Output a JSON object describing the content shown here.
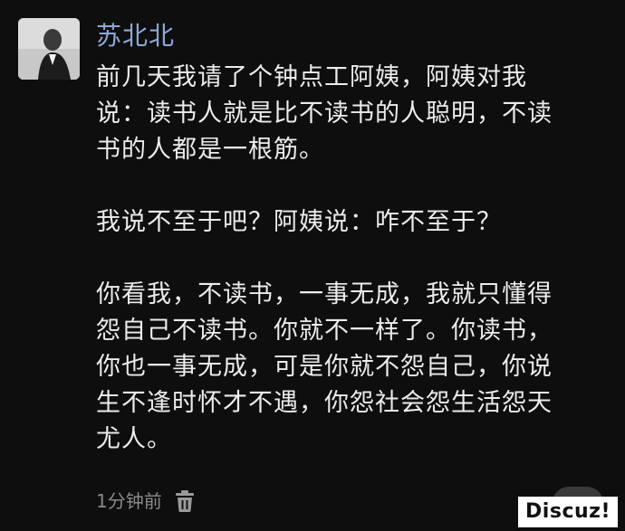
{
  "post": {
    "username": "苏北北",
    "paragraphs": [
      "前几天我请了个钟点工阿姨，阿姨对我\n说：读书人就是比不读书的人聪明，不读\n书的人都是一根筋。",
      "我说不至于吧？阿姨说：咋不至于？",
      "你看我，不读书，一事无成，我就只懂得\n怨自己不读书。你就不一样了。你读书，\n你也一事无成，可是你就不怨自己，你说\n生不逢时怀才不遇，你怨社会怨生活怨天\n尤人。"
    ],
    "time": "1分钟前",
    "delete_icon": "trash-icon",
    "more_icon": "more-icon"
  },
  "watermark": "Discuz!",
  "colors": {
    "background": "#0e0e0e",
    "username": "#8fa8d6",
    "text": "#ececec",
    "meta": "#8a8a8a"
  }
}
